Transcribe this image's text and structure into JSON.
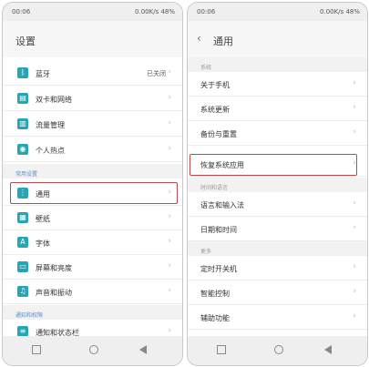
{
  "left": {
    "status": {
      "time": "00:06",
      "net": "0.00K/s  48%"
    },
    "title": "设置",
    "rows_top": [
      {
        "label": "蓝牙",
        "status": "已关闭",
        "icon": "bluetooth-icon"
      },
      {
        "label": "双卡和网络",
        "icon": "sim-card-icon"
      },
      {
        "label": "流量管理",
        "icon": "data-usage-icon"
      },
      {
        "label": "个人热点",
        "icon": "hotspot-icon"
      }
    ],
    "section_common": "常用设置",
    "rows_common": [
      {
        "label": "通用",
        "icon": "general-icon"
      },
      {
        "label": "壁纸",
        "icon": "wallpaper-icon"
      },
      {
        "label": "字体",
        "icon": "font-icon"
      },
      {
        "label": "屏幕和亮度",
        "icon": "display-icon"
      },
      {
        "label": "声音和振动",
        "icon": "sound-icon"
      }
    ],
    "section_notify": "通知和权限",
    "rows_notify": [
      {
        "label": "通知和状态栏",
        "icon": "notification-icon"
      }
    ]
  },
  "right": {
    "status": {
      "time": "00:06",
      "net": "0.00K/s  48%"
    },
    "title": "通用",
    "section_system": "系统",
    "rows_system": [
      {
        "label": "关于手机"
      },
      {
        "label": "系统更新"
      },
      {
        "label": "备份与重置"
      },
      {
        "label": "恢复系统应用"
      }
    ],
    "section_time": "时间和语言",
    "rows_time": [
      {
        "label": "语言和输入法"
      },
      {
        "label": "日期和时间"
      }
    ],
    "section_more": "更多",
    "rows_more": [
      {
        "label": "定时开关机"
      },
      {
        "label": "智能控制"
      },
      {
        "label": "辅助功能"
      }
    ]
  }
}
